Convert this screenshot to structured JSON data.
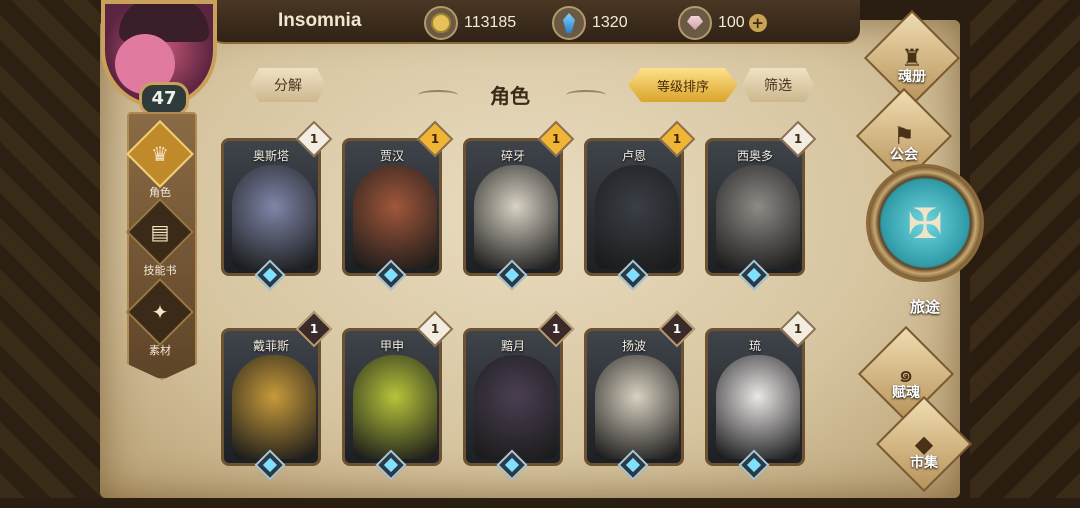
{
  "player": {
    "name": "Insomnia",
    "level": "47"
  },
  "resources": [
    {
      "icon": "gold-coin-icon",
      "value": "113185"
    },
    {
      "icon": "blue-crystal-icon",
      "value": "1320"
    },
    {
      "icon": "pink-gem-icon",
      "value": "100",
      "add": "+"
    }
  ],
  "left_nav": [
    {
      "label": "角色",
      "icon": "helmet-icon",
      "active": true
    },
    {
      "label": "技能书",
      "icon": "book-icon",
      "active": false
    },
    {
      "label": "素材",
      "icon": "beast-icon",
      "active": false
    }
  ],
  "header": {
    "decompose_label": "分解",
    "title": "角色",
    "sort_label": "等级排序",
    "filter_label": "筛选"
  },
  "characters": [
    {
      "name": "奥斯塔",
      "level": "1",
      "badge": "white"
    },
    {
      "name": "贾汉",
      "level": "1",
      "badge": "gold"
    },
    {
      "name": "碎牙",
      "level": "1",
      "badge": "gold"
    },
    {
      "name": "卢恩",
      "level": "1",
      "badge": "gold"
    },
    {
      "name": "西奥多",
      "level": "1",
      "badge": "white"
    },
    {
      "name": "戴菲斯",
      "level": "1",
      "badge": "dark"
    },
    {
      "name": "甲申",
      "level": "1",
      "badge": "white"
    },
    {
      "name": "黯月",
      "level": "1",
      "badge": "dark"
    },
    {
      "name": "扬波",
      "level": "1",
      "badge": "dark"
    },
    {
      "name": "琉",
      "level": "1",
      "badge": "white"
    }
  ],
  "right_nav": {
    "soul_book": "魂册",
    "guild": "公会",
    "journey": "旅途",
    "endow_soul": "赋魂",
    "market": "市集"
  },
  "colors": {
    "accent_gold": "#f0b534",
    "parchment": "#e2d3b2",
    "socket_cyan": "#7fe0ff"
  }
}
